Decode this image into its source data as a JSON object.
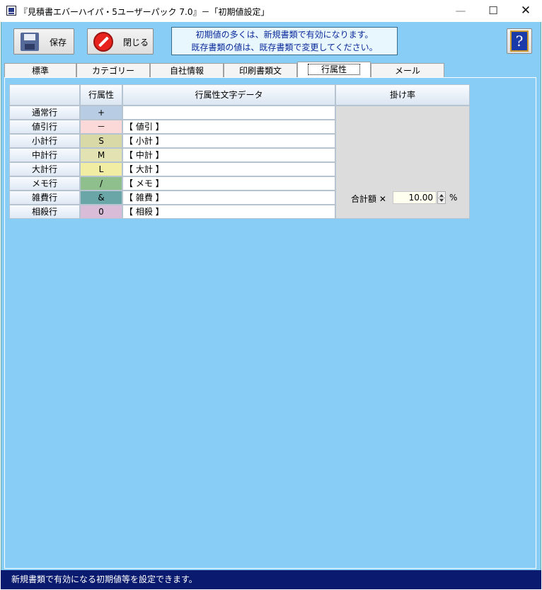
{
  "window": {
    "title": "『見積書エバーハイパ・5ユーザーパック 7.0』－「初期値設定」",
    "min": "—",
    "max": "☐",
    "close": "✕"
  },
  "toolbar": {
    "save_label": "保存",
    "close_label": "閉じる",
    "help_label": "?"
  },
  "notice": {
    "line1": "初期値の多くは、新規書類で有効になります。",
    "line2": "既存書類の値は、既存書類で変更してください。"
  },
  "tabs": [
    {
      "label": "標準"
    },
    {
      "label": "カテゴリー"
    },
    {
      "label": "自社情報"
    },
    {
      "label": "印刷書類文"
    },
    {
      "label": "行属性"
    },
    {
      "label": "メール"
    }
  ],
  "active_tab": 4,
  "table": {
    "headers": {
      "attr": "行属性",
      "text": "行属性文字データ",
      "rate": "掛け率"
    },
    "rows": [
      {
        "label": "通常行",
        "attr": "+",
        "text": "",
        "color": "#b8cde4"
      },
      {
        "label": "値引行",
        "attr": "－",
        "text": "【 値引 】",
        "color": "#fcd9d9"
      },
      {
        "label": "小計行",
        "attr": "S",
        "text": "【 小計 】",
        "color": "#d9d9a8"
      },
      {
        "label": "中計行",
        "attr": "M",
        "text": "【 中計 】",
        "color": "#e2e2b2"
      },
      {
        "label": "大計行",
        "attr": "L",
        "text": "【 大計 】",
        "color": "#f1eda2"
      },
      {
        "label": "メモ行",
        "attr": "/",
        "text": "【 メモ 】",
        "color": "#8fbf8c"
      },
      {
        "label": "雑費行",
        "attr": "&",
        "text": "【 雑費 】",
        "color": "#6aa6a8"
      },
      {
        "label": "相殺行",
        "attr": "0",
        "text": "【 相殺 】",
        "color": "#d8bcd8"
      }
    ],
    "rate": {
      "label": "合計額 ✕",
      "value": "10.00",
      "unit": "%"
    }
  },
  "status": {
    "text": "新規書類で有効になる初期値等を設定できます。"
  }
}
